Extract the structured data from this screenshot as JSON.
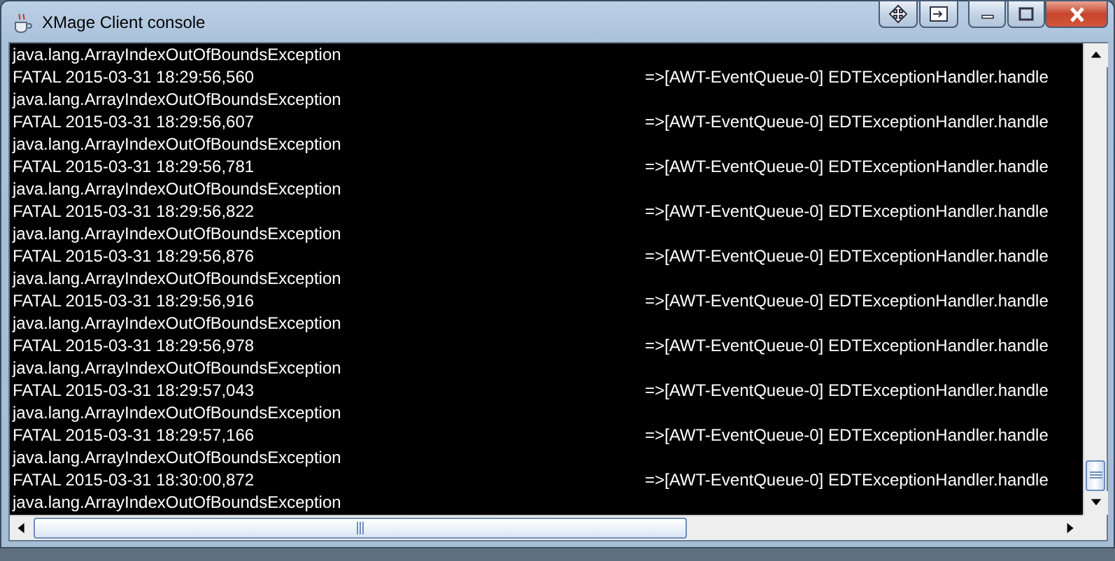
{
  "window": {
    "title": "XMage Client console"
  },
  "console": {
    "top_partial": "java.lang.ArrayIndexOutOfBoundsException",
    "entries": [
      {
        "header": "FATAL 2015-03-31 18:29:56,560",
        "source": "=>[AWT-EventQueue-0] EDTExceptionHandler.handle",
        "message": "java.lang.ArrayIndexOutOfBoundsException"
      },
      {
        "header": "FATAL 2015-03-31 18:29:56,607",
        "source": "=>[AWT-EventQueue-0] EDTExceptionHandler.handle",
        "message": "java.lang.ArrayIndexOutOfBoundsException"
      },
      {
        "header": "FATAL 2015-03-31 18:29:56,781",
        "source": "=>[AWT-EventQueue-0] EDTExceptionHandler.handle",
        "message": "java.lang.ArrayIndexOutOfBoundsException"
      },
      {
        "header": "FATAL 2015-03-31 18:29:56,822",
        "source": "=>[AWT-EventQueue-0] EDTExceptionHandler.handle",
        "message": "java.lang.ArrayIndexOutOfBoundsException"
      },
      {
        "header": "FATAL 2015-03-31 18:29:56,876",
        "source": "=>[AWT-EventQueue-0] EDTExceptionHandler.handle",
        "message": "java.lang.ArrayIndexOutOfBoundsException"
      },
      {
        "header": "FATAL 2015-03-31 18:29:56,916",
        "source": "=>[AWT-EventQueue-0] EDTExceptionHandler.handle",
        "message": "java.lang.ArrayIndexOutOfBoundsException"
      },
      {
        "header": "FATAL 2015-03-31 18:29:56,978",
        "source": "=>[AWT-EventQueue-0] EDTExceptionHandler.handle",
        "message": "java.lang.ArrayIndexOutOfBoundsException"
      },
      {
        "header": "FATAL 2015-03-31 18:29:57,043",
        "source": "=>[AWT-EventQueue-0] EDTExceptionHandler.handle",
        "message": "java.lang.ArrayIndexOutOfBoundsException"
      },
      {
        "header": "FATAL 2015-03-31 18:29:57,166",
        "source": "=>[AWT-EventQueue-0] EDTExceptionHandler.handle",
        "message": "java.lang.ArrayIndexOutOfBoundsException"
      },
      {
        "header": "FATAL 2015-03-31 18:30:00,872",
        "source": "=>[AWT-EventQueue-0] EDTExceptionHandler.handle",
        "message": "java.lang.ArrayIndexOutOfBoundsException"
      }
    ]
  }
}
